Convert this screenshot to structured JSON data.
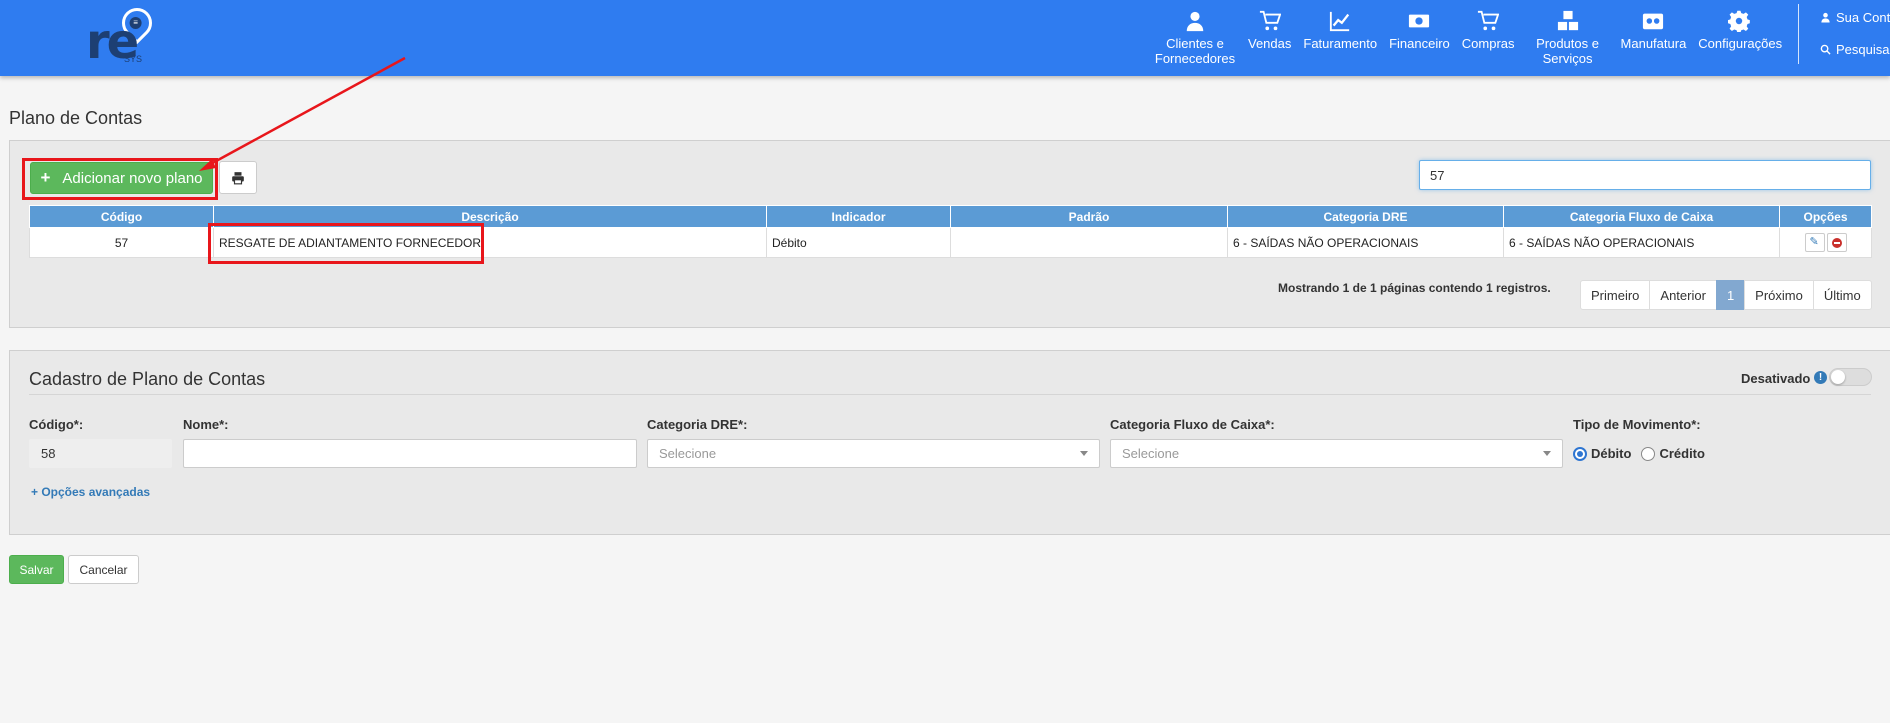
{
  "nav": {
    "items": [
      {
        "label": "Clientes e Fornecedores",
        "icon": "user-icon"
      },
      {
        "label": "Vendas",
        "icon": "cart-icon"
      },
      {
        "label": "Faturamento",
        "icon": "line-chart-icon"
      },
      {
        "label": "Financeiro",
        "icon": "money-icon"
      },
      {
        "label": "Compras",
        "icon": "cart-icon"
      },
      {
        "label": "Produtos e Serviços",
        "icon": "cubes-icon"
      },
      {
        "label": "Manufatura",
        "icon": "industry-icon"
      },
      {
        "label": "Configurações",
        "icon": "gear-icon"
      }
    ],
    "account_label": "Sua Conta",
    "search_label": "Pesquisar"
  },
  "logo": {
    "text": "re",
    "sub": "SYS"
  },
  "page": {
    "title": "Plano de Contas"
  },
  "toolbar": {
    "add_label": "Adicionar novo plano",
    "search_value": "57"
  },
  "table": {
    "headers": [
      "Código",
      "Descrição",
      "Indicador",
      "Padrão",
      "Categoria DRE",
      "Categoria Fluxo de Caixa",
      "Opções"
    ],
    "rows": [
      {
        "codigo": "57",
        "descricao": "RESGATE DE ADIANTAMENTO FORNECEDOR",
        "indicador": "Débito",
        "padrao": "",
        "categoria_dre": "6 - SAÍDAS NÃO OPERACIONAIS",
        "categoria_fluxo": "6 - SAÍDAS NÃO OPERACIONAIS"
      }
    ]
  },
  "pagination": {
    "info": "Mostrando 1 de 1 páginas contendo 1 registros.",
    "first": "Primeiro",
    "prev": "Anterior",
    "current": "1",
    "next": "Próximo",
    "last": "Último"
  },
  "form": {
    "title": "Cadastro de Plano de Contas",
    "disabled_label": "Desativado",
    "codigo_label": "Código*:",
    "codigo_value": "58",
    "nome_label": "Nome*:",
    "nome_value": "",
    "dre_label": "Categoria DRE*:",
    "dre_placeholder": "Selecione",
    "fluxo_label": "Categoria Fluxo de Caixa*:",
    "fluxo_placeholder": "Selecione",
    "tipo_label": "Tipo de Movimento*:",
    "tipo_debito": "Débito",
    "tipo_credito": "Crédito",
    "advanced_label": "Opções avançadas"
  },
  "actions": {
    "save_label": "Salvar",
    "cancel_label": "Cancelar"
  },
  "colors": {
    "navbar": "#2f7cf0",
    "primary_success": "#5cb85c",
    "table_header": "#5b9bd5",
    "annotation_red": "#e8161b"
  }
}
